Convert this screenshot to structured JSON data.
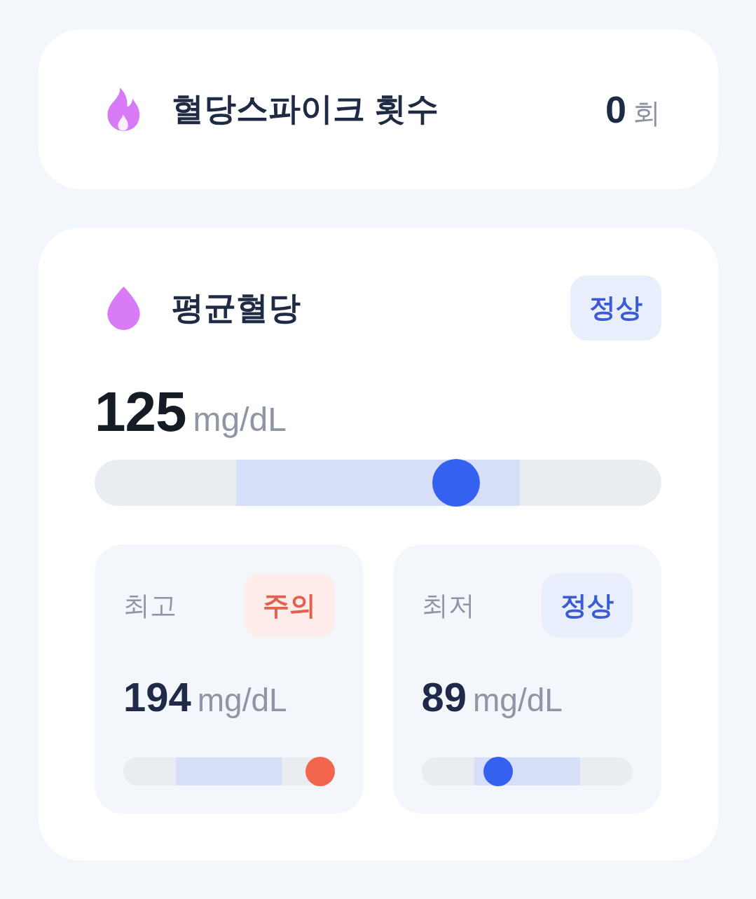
{
  "spike_card": {
    "title": "혈당스파이크 횟수",
    "count": "0",
    "unit": "회"
  },
  "average_card": {
    "title": "평균혈당",
    "status": {
      "kind": "normal",
      "label": "정상"
    },
    "value": "125",
    "unit": "mg/dL",
    "gauge": {
      "level": 0.65
    },
    "stats": [
      {
        "label": "최고",
        "status": {
          "kind": "caution",
          "label": "주의"
        },
        "value": "194",
        "unit": "mg/dL",
        "gauge": {
          "level": 1.0
        }
      },
      {
        "label": "최저",
        "status": {
          "kind": "normal",
          "label": "정상"
        },
        "value": "89",
        "unit": "mg/dL",
        "gauge": {
          "level": 0.34
        }
      }
    ]
  }
}
